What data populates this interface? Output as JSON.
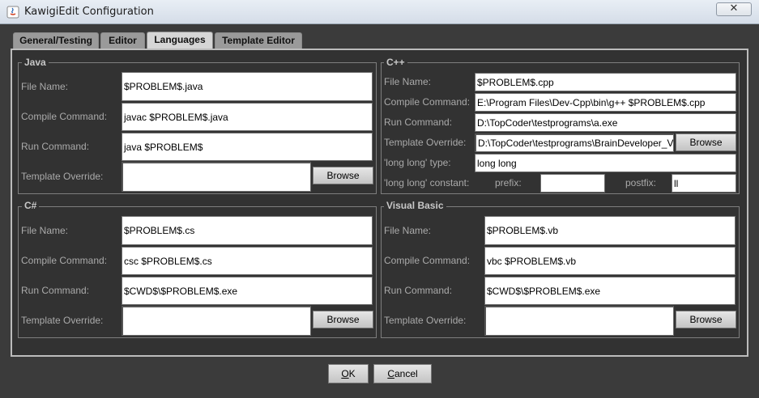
{
  "window": {
    "title": "KawigiEdit Configuration",
    "close_glyph": "✕"
  },
  "tabs": [
    {
      "label": "General/Testing",
      "active": false
    },
    {
      "label": "Editor",
      "active": false
    },
    {
      "label": "Languages",
      "active": true
    },
    {
      "label": "Template Editor",
      "active": false
    }
  ],
  "java": {
    "title": "Java",
    "file_name_label": "File Name:",
    "file_name": "$PROBLEM$.java",
    "compile_label": "Compile Command:",
    "compile": "javac $PROBLEM$.java",
    "run_label": "Run Command:",
    "run": "java $PROBLEM$",
    "template_label": "Template Override:",
    "template": "",
    "browse": "Browse"
  },
  "cpp": {
    "title": "C++",
    "file_name_label": "File Name:",
    "file_name": "$PROBLEM$.cpp",
    "compile_label": "Compile Command:",
    "compile": "E:\\Program Files\\Dev-Cpp\\bin\\g++ $PROBLEM$.cpp",
    "run_label": "Run Command:",
    "run": "D:\\TopCoder\\testprograms\\a.exe",
    "template_label": "Template Override:",
    "template": "D:\\TopCoder\\testprograms\\BrainDeveloper_V",
    "browse": "Browse",
    "longlong_type_label": "'long long' type:",
    "longlong_type": "long long",
    "longlong_const_label": "'long long' constant:",
    "prefix_label": "prefix:",
    "prefix": "",
    "postfix_label": "postfix:",
    "postfix": "ll"
  },
  "csharp": {
    "title": "C#",
    "file_name_label": "File Name:",
    "file_name": "$PROBLEM$.cs",
    "compile_label": "Compile Command:",
    "compile": "csc $PROBLEM$.cs",
    "run_label": "Run Command:",
    "run": "$CWD$\\$PROBLEM$.exe",
    "template_label": "Template Override:",
    "template": "",
    "browse": "Browse"
  },
  "vb": {
    "title": "Visual Basic",
    "file_name_label": "File Name:",
    "file_name": "$PROBLEM$.vb",
    "compile_label": "Compile Command:",
    "compile": "vbc $PROBLEM$.vb",
    "run_label": "Run Command:",
    "run": "$CWD$\\$PROBLEM$.exe",
    "template_label": "Template Override:",
    "template": "",
    "browse": "Browse"
  },
  "buttons": {
    "ok_first": "O",
    "ok_rest": "K",
    "cancel_first": "C",
    "cancel_rest": "ancel"
  }
}
